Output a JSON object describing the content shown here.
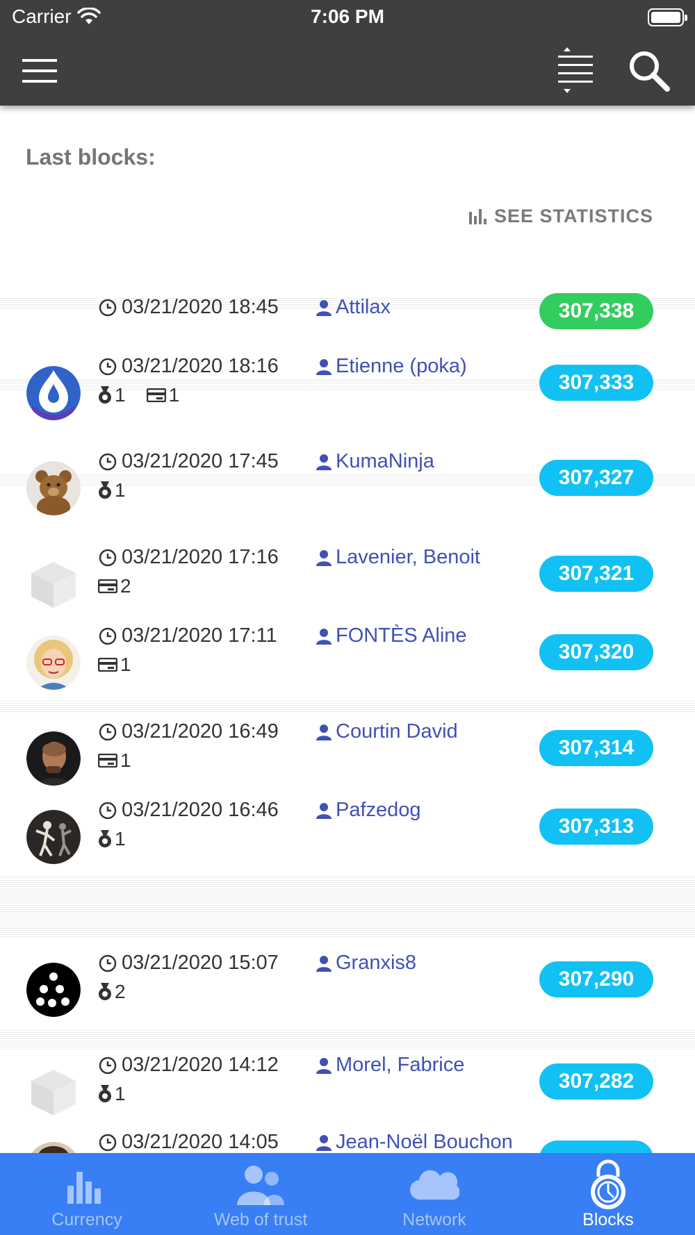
{
  "status_bar": {
    "carrier": "Carrier",
    "time": "7:06 PM"
  },
  "header": {
    "section_title": "Last blocks:",
    "stats_button": "SEE STATISTICS"
  },
  "blocks": [
    {
      "date": "03/21/2020 18:45",
      "issuer": "Attilax",
      "number": "307,338",
      "badge_color": "#33cd5f",
      "avatar": "none",
      "certs": "",
      "txs": ""
    },
    {
      "date": "03/21/2020 18:16",
      "issuer": "Etienne (poka)",
      "number": "307,333",
      "badge_color": "#11c1f3",
      "avatar": "drop-logo",
      "certs": "1",
      "txs": "1"
    },
    {
      "date": "03/21/2020 17:45",
      "issuer": "KumaNinja",
      "number": "307,327",
      "badge_color": "#11c1f3",
      "avatar": "teddy-bear",
      "certs": "1",
      "txs": ""
    },
    {
      "date": "03/21/2020 17:16",
      "issuer": "Lavenier, Benoit",
      "number": "307,321",
      "badge_color": "#11c1f3",
      "avatar": "default-cube",
      "certs": "",
      "txs": "2"
    },
    {
      "date": "03/21/2020 17:11",
      "issuer": "FONTÈS Aline",
      "number": "307,320",
      "badge_color": "#11c1f3",
      "avatar": "cartoon-face",
      "certs": "",
      "txs": "1"
    },
    {
      "date": "03/21/2020 16:49",
      "issuer": "Courtin David",
      "number": "307,314",
      "badge_color": "#11c1f3",
      "avatar": "photo-man",
      "certs": "",
      "txs": "1"
    },
    {
      "date": "03/21/2020 16:46",
      "issuer": "Pafzedog",
      "number": "307,313",
      "badge_color": "#11c1f3",
      "avatar": "dancers",
      "certs": "1",
      "txs": ""
    },
    {
      "date": "03/21/2020 15:07",
      "issuer": "Granxis8",
      "number": "307,290",
      "badge_color": "#11c1f3",
      "avatar": "dots",
      "certs": "2",
      "txs": ""
    },
    {
      "date": "03/21/2020 14:12",
      "issuer": "Morel, Fabrice",
      "number": "307,282",
      "badge_color": "#11c1f3",
      "avatar": "default-cube",
      "certs": "1",
      "txs": ""
    },
    {
      "date": "03/21/2020 14:05",
      "issuer": "Jean-Noël Bouchon",
      "number": "",
      "badge_color": "#11c1f3",
      "avatar": "photo-partial",
      "certs": "",
      "txs": ""
    }
  ],
  "tabs": [
    {
      "label": "Currency",
      "icon": "bar-chart-icon",
      "active": false
    },
    {
      "label": "Web of trust",
      "icon": "people-icon",
      "active": false
    },
    {
      "label": "Network",
      "icon": "cloud-icon",
      "active": false
    },
    {
      "label": "Blocks",
      "icon": "lock-icon",
      "active": true
    }
  ],
  "colors": {
    "bar": "#3f3f3f",
    "tabbar": "#387ef5",
    "link": "#3f51b5",
    "balanced": "#33cd5f",
    "calm": "#11c1f3"
  }
}
